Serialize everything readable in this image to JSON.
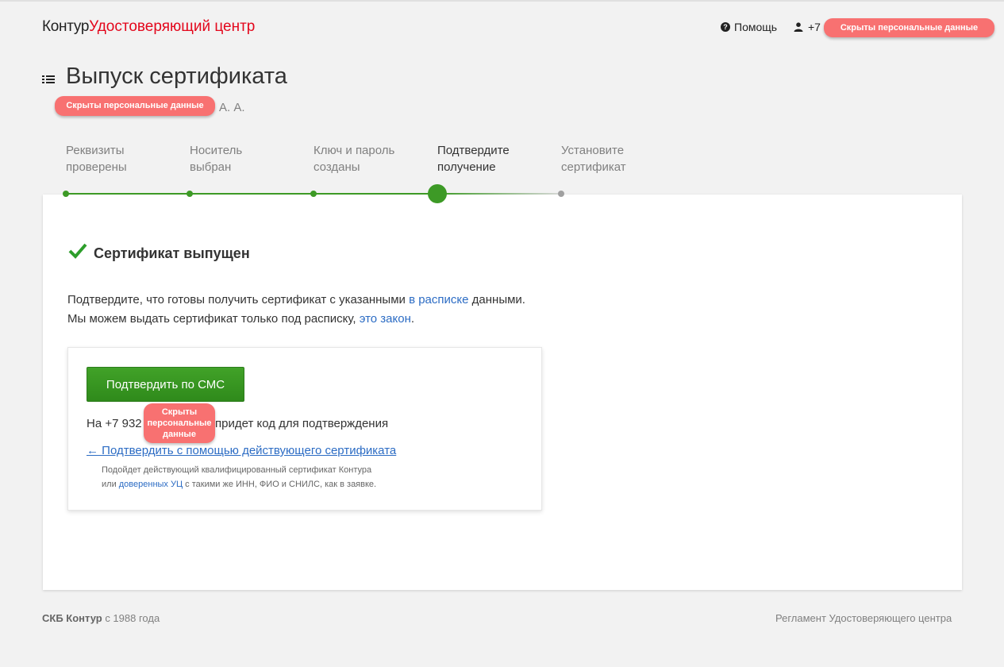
{
  "header": {
    "brand": "Контур",
    "product": "Удостоверяющий центр",
    "help_label": "Помощь",
    "user_phone_prefix": "+7",
    "hidden_data_label": "Скрыты персональные данные"
  },
  "page": {
    "title": "Выпуск сертификата",
    "subtitle_initials": "А. А.",
    "subtitle_hidden_label": "Скрыты персональные данные"
  },
  "steps": [
    {
      "line1": "Реквизиты",
      "line2": "проверены",
      "state": "done"
    },
    {
      "line1": "Носитель",
      "line2": "выбран",
      "state": "done"
    },
    {
      "line1": "Ключ и пароль",
      "line2": "созданы",
      "state": "done"
    },
    {
      "line1": "Подтвердите",
      "line2": "получение",
      "state": "current"
    },
    {
      "line1": "Установите",
      "line2": "сертификат",
      "state": "pending"
    }
  ],
  "main": {
    "status": "Сертификат выпущен",
    "para1_before": "Подтвердите, что готовы получить сертификат с указанными ",
    "para1_link": "в расписке",
    "para1_after": " данными.",
    "para2_before": "Мы можем выдать сертификат только под расписку, ",
    "para2_link": "это закон",
    "para2_after": ".",
    "confirm_button": "Подтвердить по СМС",
    "sms_prefix": "На +7 932",
    "sms_suffix": "придет код для подтверждения",
    "phone_hidden_label": "Скрыты персональные данные",
    "alt_link": "← Подтвердить с помощью действующего сертификата",
    "hint_line1": "Подойдет действующий квалифицированный сертификат Контура",
    "hint_line2_before": "или ",
    "hint_line2_link": "доверенных УЦ",
    "hint_line2_after": " с такими же ИНН, ФИО и СНИЛС, как в заявке."
  },
  "footer": {
    "company": "СКБ Контур",
    "since": " с 1988 года",
    "regulation_link": "Регламент Удостоверяющего центра"
  },
  "colors": {
    "brand_red": "#e3071c",
    "accent_green": "#3d9a26",
    "link_blue": "#2c6cc4",
    "hidden_badge": "#f87171",
    "pending_gray": "#a0a0a0"
  }
}
